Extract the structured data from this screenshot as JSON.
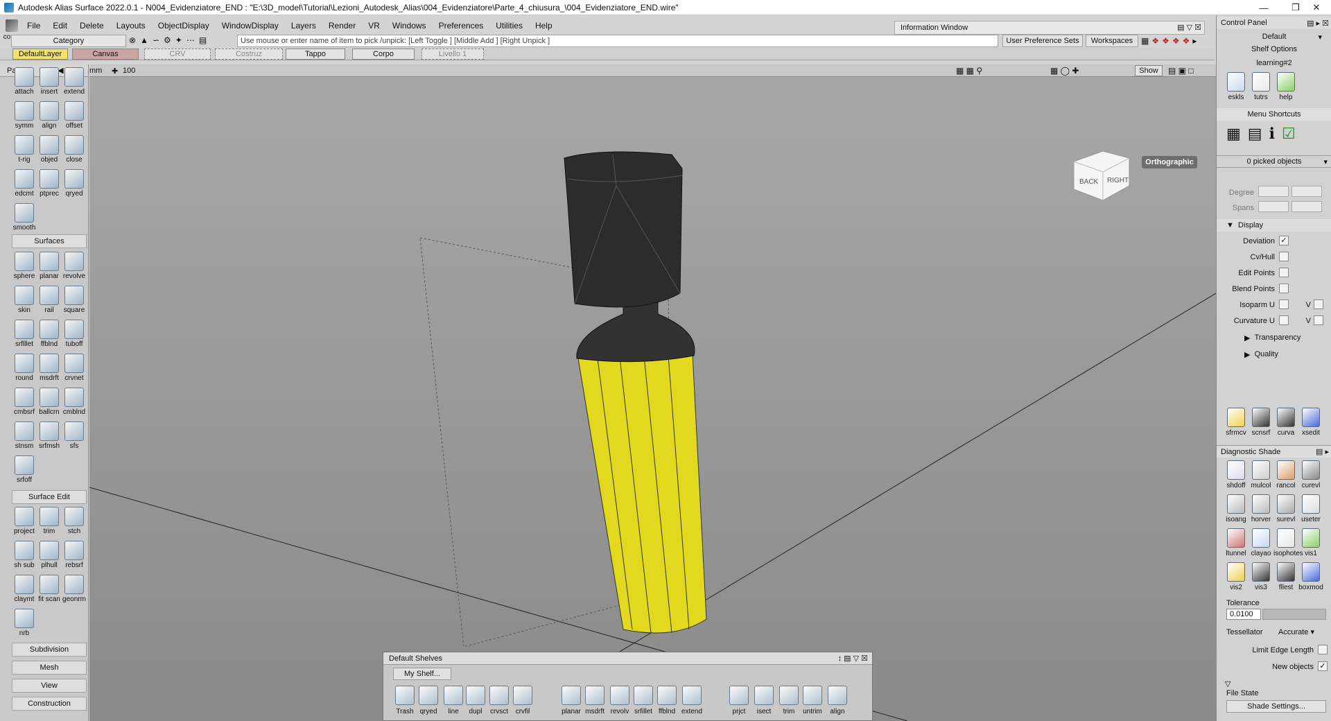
{
  "window": {
    "title": "Autodesk Alias Surface 2022.0.1    - N004_Evidenziatore_END : \"E:\\3D_model\\Tutorial\\Lezioni_Autodesk_Alias\\004_Evidenziatore\\Parte_4_chiusura_\\004_Evidenziatore_END.wire\""
  },
  "menu": [
    "File",
    "Edit",
    "Delete",
    "Layouts",
    "ObjectDisplay",
    "WindowDisplay",
    "Layers",
    "Render",
    "VR",
    "Windows",
    "Preferences",
    "Utilities",
    "Help"
  ],
  "comp_label": "comp",
  "info_window": "Information Window",
  "category": "Category",
  "prompt": "Use mouse or enter name of item to pick /unpick: [Left Toggle ] [Middle Add ] [Right Unpick ]",
  "user_pref_sets": "User Preference Sets",
  "workspaces": "Workspaces",
  "layers": [
    "DefaultLayer",
    "Canvas",
    "CRV",
    "Costruz",
    "Tappo",
    "Corpo",
    "Livello 1"
  ],
  "palette": {
    "title": "Palette",
    "top_tools": [
      "attach",
      "insert",
      "extend",
      "symm",
      "align",
      "offset",
      "t-rig",
      "objed",
      "close",
      "edcmt",
      "ptprec",
      "qryed",
      "smooth"
    ],
    "surfaces_label": "Surfaces",
    "surface_tools": [
      "sphere",
      "planar",
      "revolve",
      "skin",
      "rail",
      "square",
      "srflllet",
      "ffblnd",
      "tuboff",
      "round",
      "msdrft",
      "crvnet",
      "cmbsrf",
      "ballcrn",
      "cmblnd",
      "stnsm",
      "srfmsh",
      "sfs",
      "srfoff"
    ],
    "surface_edit_label": "Surface Edit",
    "surface_edit_tools": [
      "project",
      "trim",
      "stch",
      "sh sub",
      "plhull",
      "rebsrf",
      "claymt",
      "fit scan",
      "geonrm",
      "nrb"
    ],
    "bottom_sections": [
      "Subdivision",
      "Mesh",
      "View",
      "Construction"
    ]
  },
  "viewport": {
    "units": "mm",
    "grid": "100",
    "show": "Show",
    "view_label": "Orthographic",
    "cube_back": "BACK",
    "cube_right": "RIGHT"
  },
  "control_panel": {
    "title": "Control Panel",
    "default": "Default",
    "shelf_options": "Shelf Options",
    "learning": "learning#2",
    "learn_tools": [
      "eskls",
      "tutrs",
      "help"
    ],
    "menu_shortcuts": "Menu Shortcuts",
    "picked": "0 picked objects",
    "degree": "Degree",
    "spans": "Spans",
    "display": "Display",
    "display_items": [
      {
        "label": "Deviation",
        "checked": true
      },
      {
        "label": "Cv/Hull",
        "checked": false
      },
      {
        "label": "Edit Points",
        "checked": false
      },
      {
        "label": "Blend Points",
        "checked": false
      },
      {
        "label": "Isoparm U",
        "checked": false,
        "v": "V"
      },
      {
        "label": "Curvature U",
        "checked": false,
        "v": "V"
      }
    ],
    "transparency": "Transparency",
    "quality": "Quality",
    "analysis_tools": [
      "sfrmcv",
      "scnsrf",
      "curva",
      "xsedit"
    ],
    "diag_title": "Diagnostic Shade",
    "diag_tools": [
      "shdoff",
      "mulcol",
      "rancol",
      "curevl",
      "isoang",
      "horver",
      "surevl",
      "useter",
      "ltunnel",
      "clayao",
      "isophotes",
      "vis1",
      "vis2",
      "vis3",
      "fllest",
      "boxmod"
    ],
    "tolerance": "Tolerance",
    "tolerance_value": "0.0100",
    "tessellator": "Tessellator",
    "tess_value": "Accurate",
    "limit_edge": "Limit Edge Length",
    "new_objects": "New objects",
    "file_state": "File State",
    "shade_settings": "Shade Settings..."
  },
  "shelves": {
    "title": "Default Shelves",
    "tab": "My Shelf...",
    "tools": [
      "Trash",
      "qryed",
      "line",
      "dupl",
      "crvsct",
      "crvfil",
      "planar",
      "msdrft",
      "revolv",
      "srfillet",
      "ffblnd",
      "extend",
      "prjct",
      "isect",
      "trim",
      "untrim",
      "align"
    ]
  },
  "colors": {
    "highlighter_body": "#e2d81e",
    "cap": "#2a2a2a",
    "viewport_bg": "#9a9a9a",
    "accent_blue": "#1d6fd8"
  }
}
